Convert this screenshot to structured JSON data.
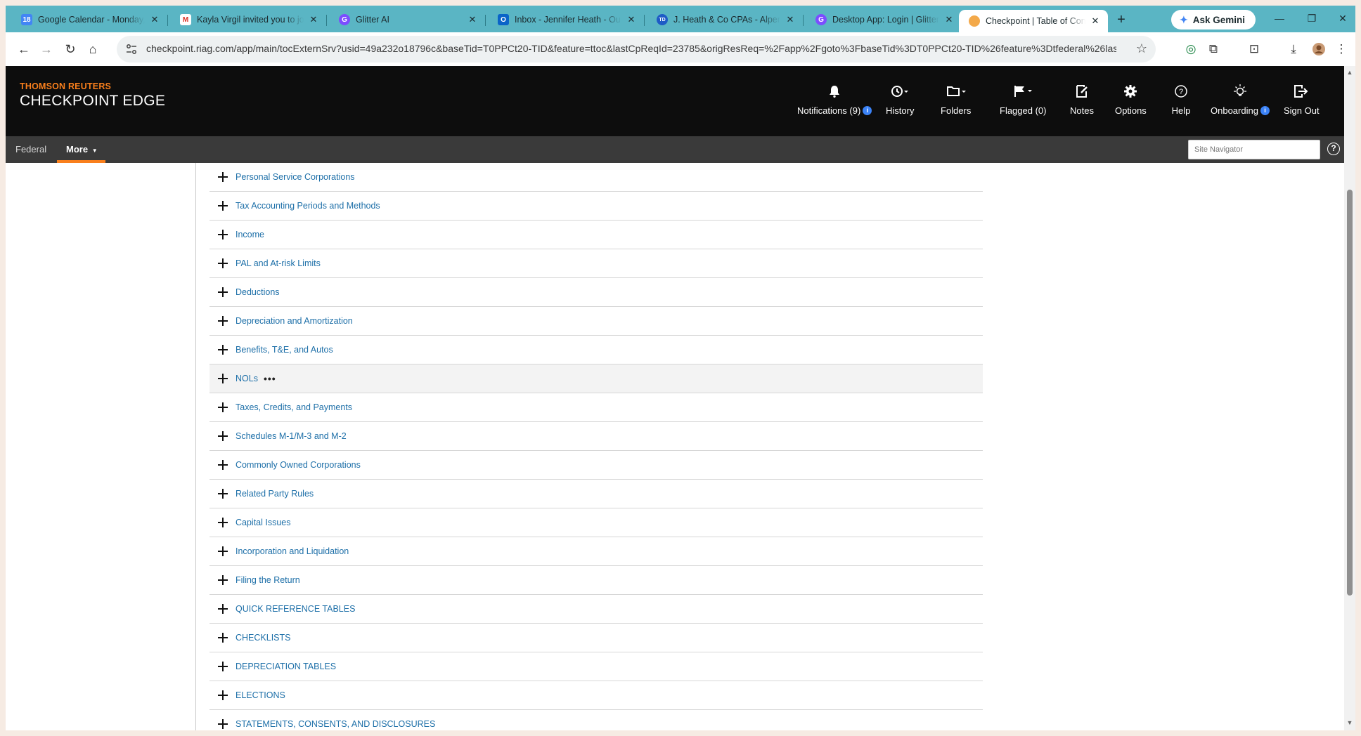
{
  "browser": {
    "tabs": [
      {
        "title": "Google Calendar - Monday, ...",
        "favicon": "calendar-icon",
        "active": false
      },
      {
        "title": "Kayla Virgil invited you to join",
        "favicon": "gmail-icon",
        "active": false
      },
      {
        "title": "Glitter AI",
        "favicon": "glitter-icon",
        "active": false
      },
      {
        "title": "Inbox - Jennifer Heath - Outlook",
        "favicon": "outlook-icon",
        "active": false
      },
      {
        "title": "J. Heath & Co CPAs - Alpering",
        "favicon": "td-icon",
        "active": false
      },
      {
        "title": "Desktop App: Login | Glitter AI",
        "favicon": "glitter-icon",
        "active": false
      },
      {
        "title": "Checkpoint | Table of Contents",
        "favicon": "checkpoint-icon",
        "active": true
      }
    ],
    "gemini_label": "Ask Gemini",
    "url": "checkpoint.riag.com/app/main/tocExternSrv?usid=49a232o18796c&baseTid=T0PPCt20-TID&feature=ttoc&lastCpReqId=23785&origResReq=%2Fapp%2Fgoto%3FbaseTid%3DT0PPCt20-TID%26feature%3Dtfederal%26lastCpReql..."
  },
  "app": {
    "brand_top": "THOMSON REUTERS",
    "brand_main": "CHECKPOINT EDGE",
    "nav": [
      {
        "label": "Notifications (9)",
        "icon": "bell-icon",
        "info": true
      },
      {
        "label": "History",
        "icon": "history-icon",
        "info": false
      },
      {
        "label": "Folders",
        "icon": "folder-icon",
        "info": false
      },
      {
        "label": "Flagged (0)",
        "icon": "flag-icon",
        "info": false
      },
      {
        "label": "Notes",
        "icon": "note-icon",
        "info": false
      },
      {
        "label": "Options",
        "icon": "gear-icon",
        "info": false
      },
      {
        "label": "Help",
        "icon": "help-icon",
        "info": false
      },
      {
        "label": "Onboarding",
        "icon": "lightbulb-icon",
        "info": true
      },
      {
        "label": "Sign Out",
        "icon": "sign-out-icon",
        "info": false
      }
    ],
    "subnav": {
      "federal": "Federal",
      "more": "More",
      "site_navigator_placeholder": "Site Navigator"
    },
    "accent_color": "#f97f1c",
    "link_color": "#1d6fa8"
  },
  "toc": {
    "items": [
      "Personal Service Corporations",
      "Tax Accounting Periods and Methods",
      "Income",
      "PAL and At-risk Limits",
      "Deductions",
      "Depreciation and Amortization",
      "Benefits, T&E, and Autos",
      "NOLs",
      "Taxes, Credits, and Payments",
      "Schedules M-1/M-3 and M-2",
      "Commonly Owned Corporations",
      "Related Party Rules",
      "Capital Issues",
      "Incorporation and Liquidation",
      "Filing the Return",
      "QUICK REFERENCE TABLES",
      "CHECKLISTS",
      "DEPRECIATION TABLES",
      "ELECTIONS",
      "STATEMENTS, CONSENTS, AND DISCLOSURES"
    ],
    "hover_item": "NOLs",
    "hover_menu": "•••"
  }
}
